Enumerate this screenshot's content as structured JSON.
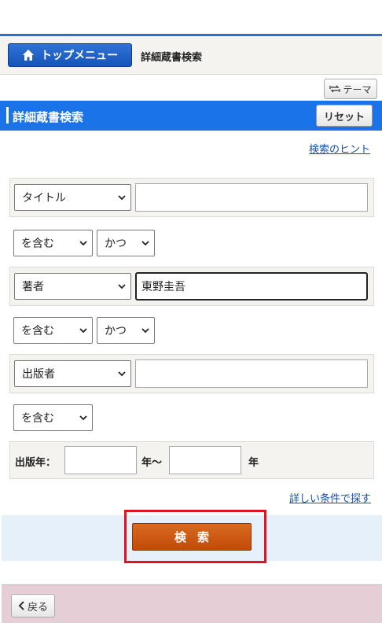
{
  "nav": {
    "top_menu_label": "トップメニュー",
    "breadcrumb": "詳細蔵書検索"
  },
  "header": {
    "theme_label": "テーマ",
    "title": "詳細蔵書検索",
    "reset_label": "リセット"
  },
  "hint_link": "検索のヒント",
  "form": {
    "fields": [
      {
        "field": "タイトル",
        "value": "",
        "match": "を含む",
        "operator": "かつ"
      },
      {
        "field": "著者",
        "value": "東野圭吾",
        "match": "を含む",
        "operator": "かつ"
      },
      {
        "field": "出版者",
        "value": "",
        "match": "を含む"
      }
    ],
    "year": {
      "label": "出版年：",
      "from": "",
      "range_sep": "年～",
      "to": "",
      "suffix": "年"
    }
  },
  "advanced_link": "詳しい条件で探す",
  "search_label": "検索",
  "back_label": "戻る",
  "colors": {
    "brand_blue": "#1a73e8",
    "search_orange": "#c24a0a",
    "highlight_red": "#e0141e"
  }
}
